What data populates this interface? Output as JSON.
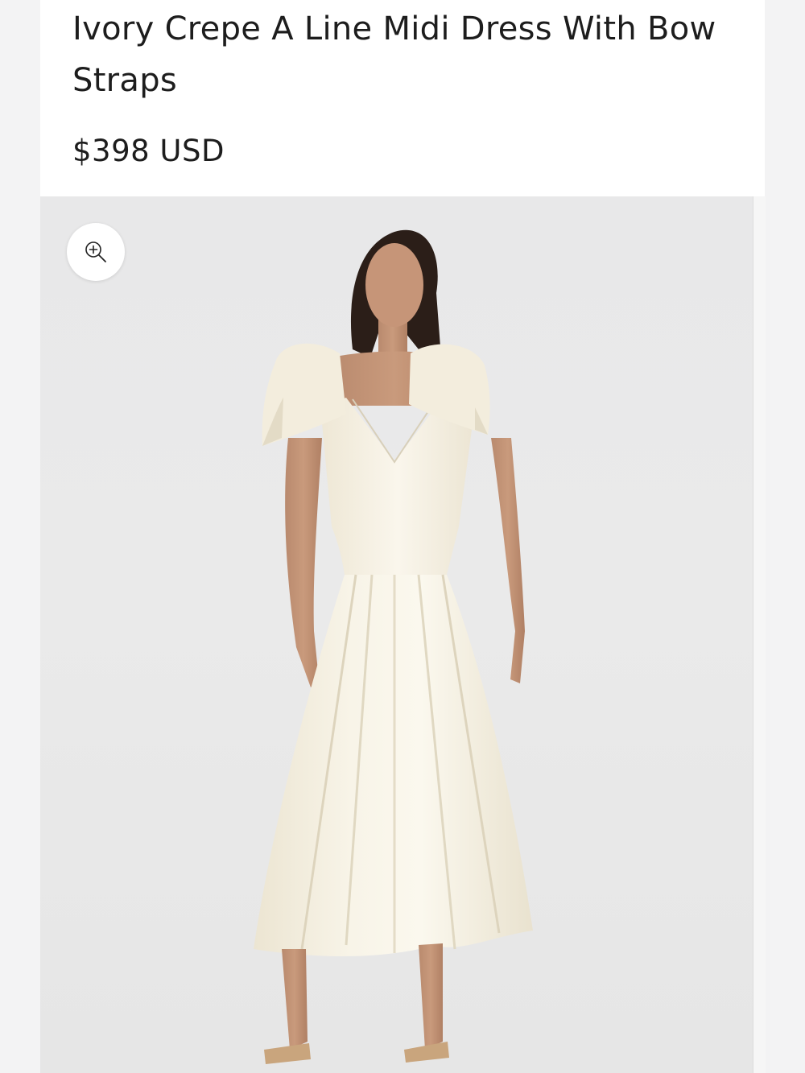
{
  "product": {
    "title": "Ivory Crepe A Line Midi Dress With Bow Straps",
    "price": "$398 USD"
  },
  "gallery": {
    "zoom_icon": "zoom-in-icon",
    "image_subject": "product-photo-dress"
  },
  "colors": {
    "text": "#1d1d1d",
    "gallery_bg": "#e8e8e9",
    "dress": "#f7f2e4"
  }
}
